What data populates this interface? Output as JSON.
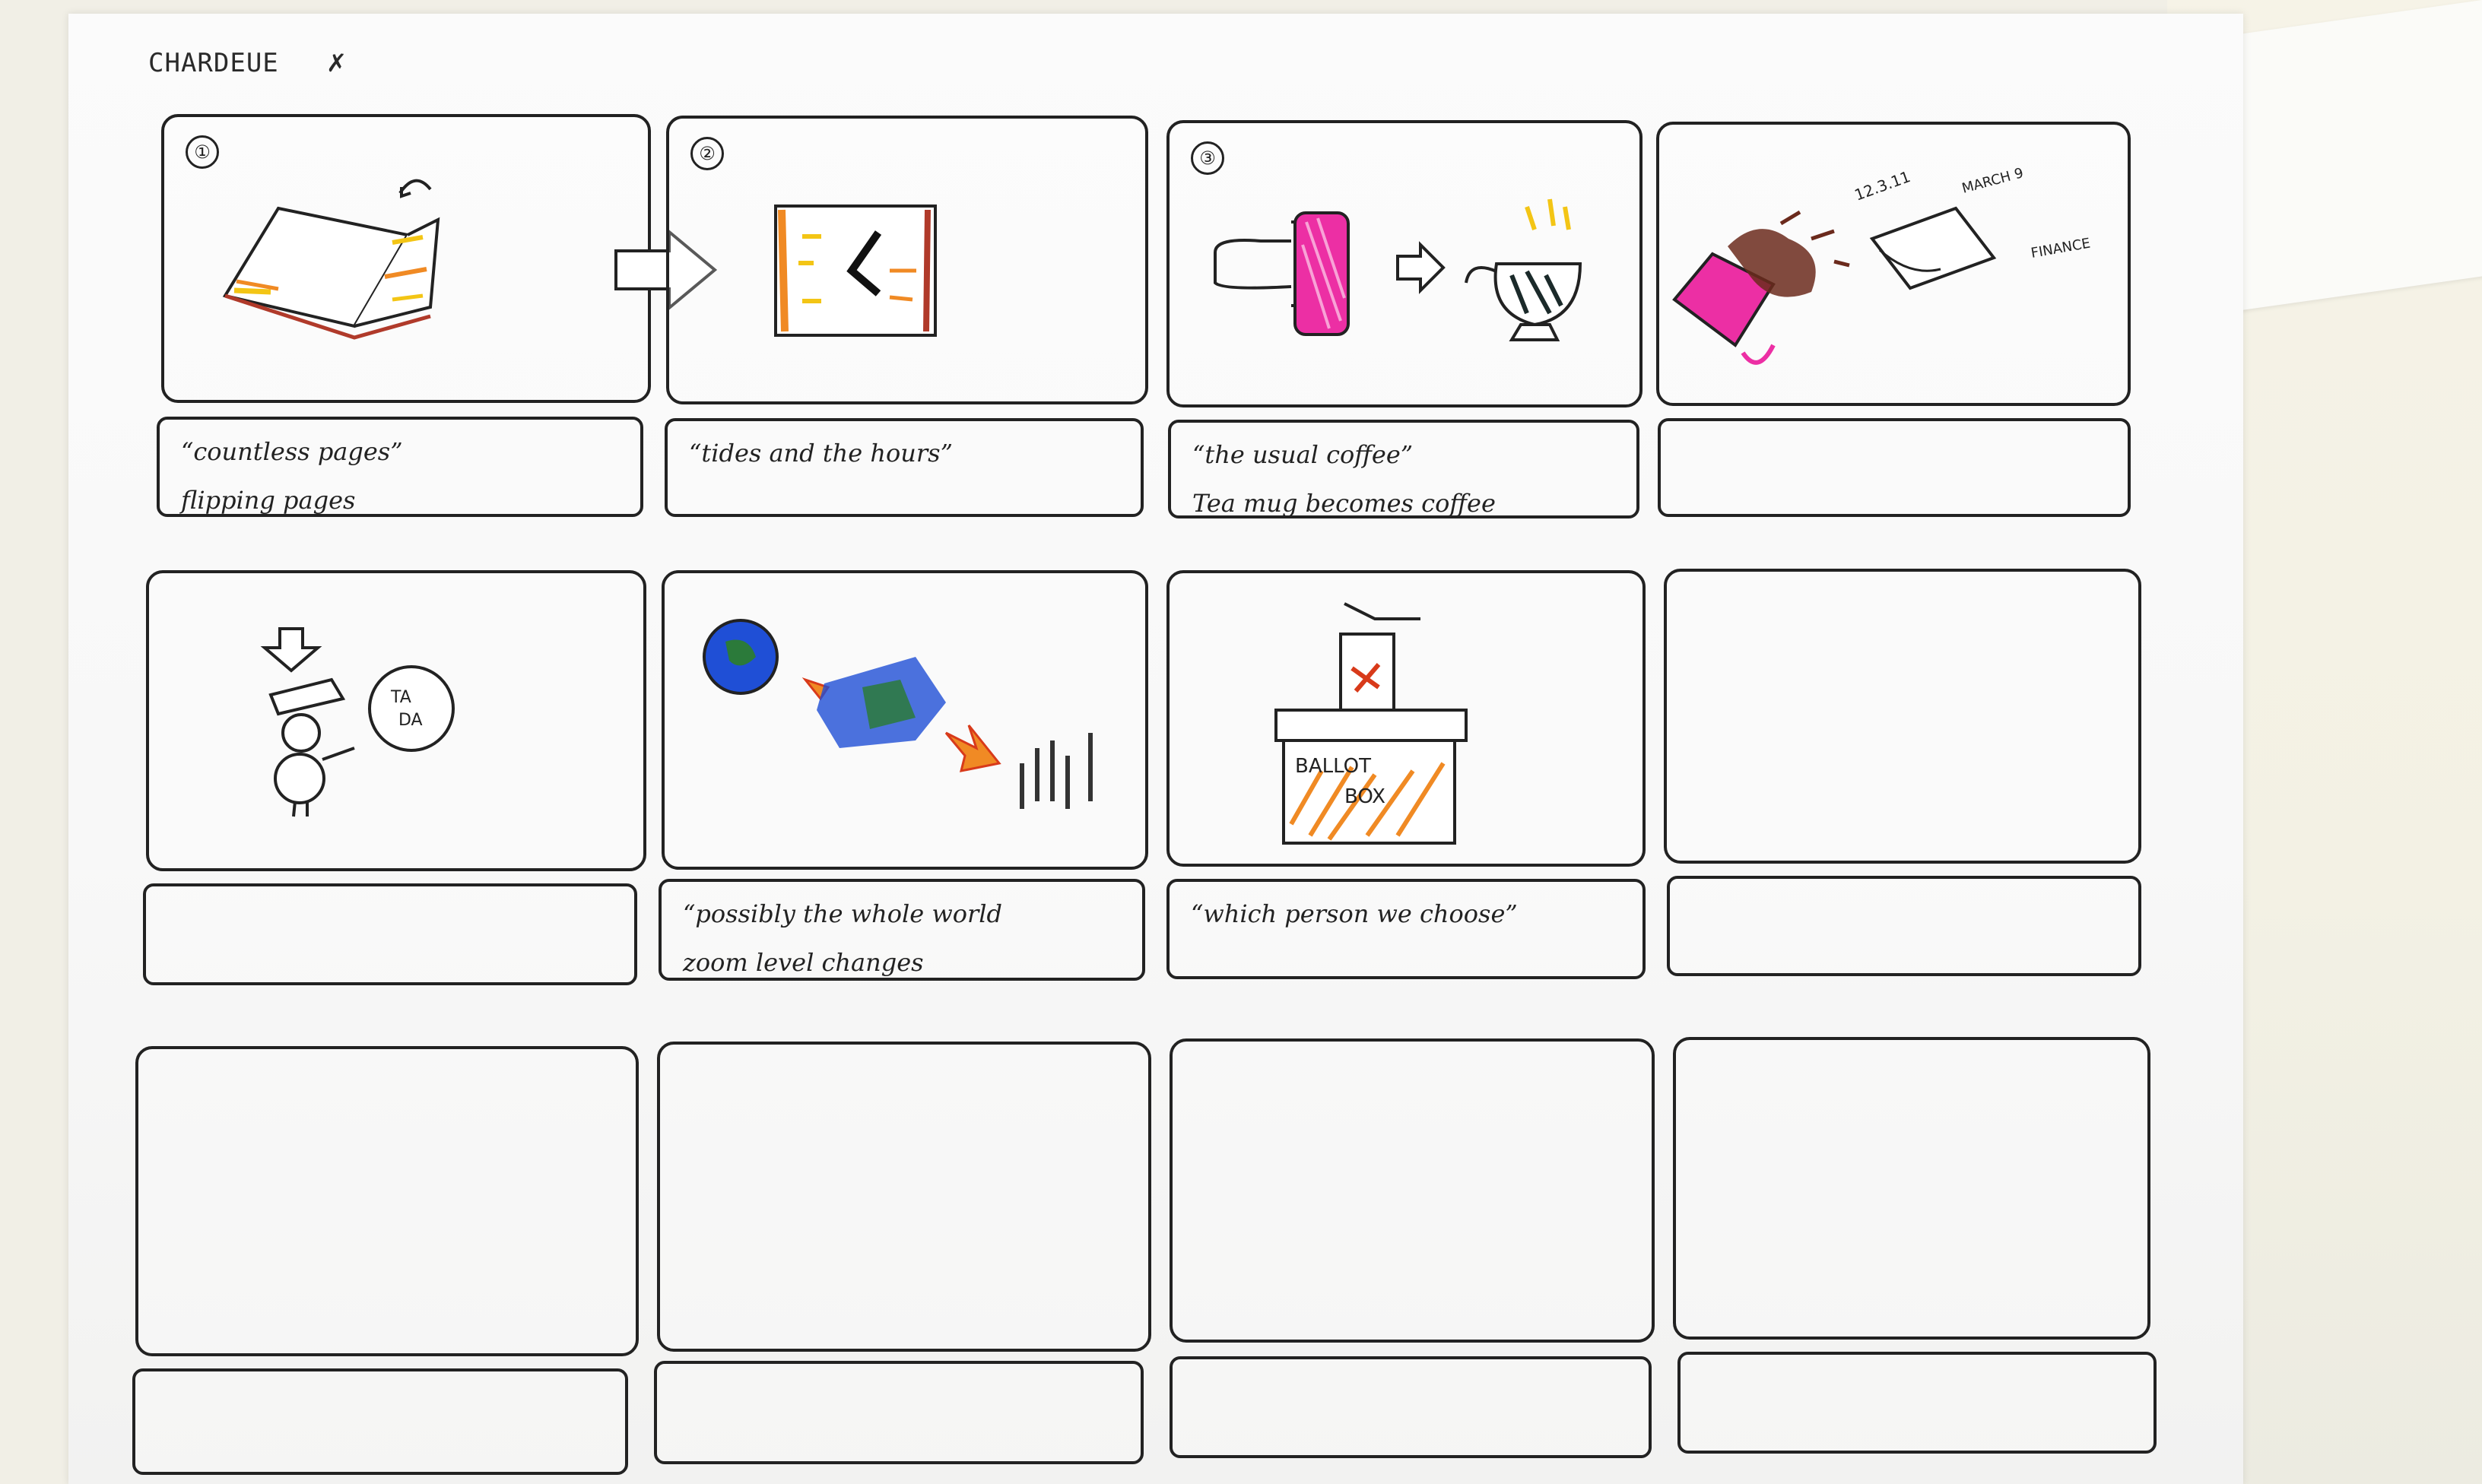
{
  "sheet": {
    "title": "CHARDEUE",
    "mark": "✗"
  },
  "panels": [
    {
      "number": "①",
      "caption_lines": [
        "“countless pages”",
        "flipping pages"
      ]
    },
    {
      "number": "②",
      "caption_lines": [
        "“tides and the hours”"
      ]
    },
    {
      "number": "③",
      "caption_lines": [
        "“the usual coffee”",
        "Tea mug becomes coffee"
      ]
    },
    {
      "number": "",
      "caption_lines": []
    },
    {
      "number": "",
      "caption_lines": []
    },
    {
      "number": "",
      "caption_lines": [
        "“possibly the whole world",
        "zoom level changes"
      ]
    },
    {
      "number": "",
      "caption_lines": [
        "“which person we choose”"
      ]
    },
    {
      "number": "",
      "caption_lines": []
    }
  ],
  "sketch_text": {
    "clock_label_1": "12.3.11",
    "clock_label_2": "MARCH 9",
    "clock_label_3": "FINANCE",
    "tada_1": "TA",
    "tada_2": "DA",
    "ballot_1": "BALLOT",
    "ballot_2": "BOX"
  },
  "colors": {
    "ink": "#222222",
    "orange": "#f08a24",
    "yellow": "#f3c515",
    "pink": "#ec2fa4",
    "blue": "#1f4fd6",
    "green": "#2b7a3a",
    "red": "#d83a1a",
    "brown": "#6b2a1c"
  }
}
